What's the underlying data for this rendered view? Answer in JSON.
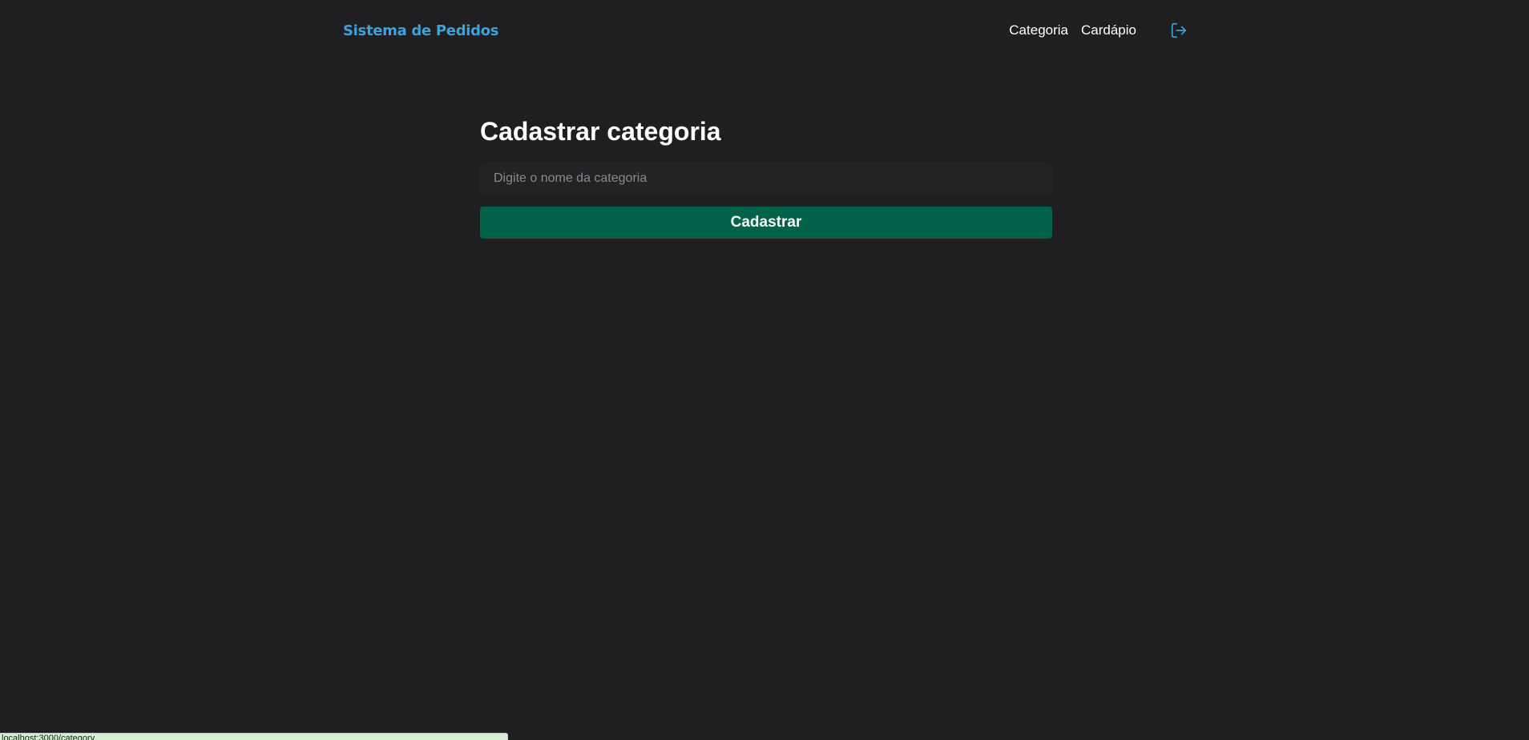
{
  "header": {
    "brand": "Sistema de Pedidos",
    "nav": [
      {
        "label": "Categoria"
      },
      {
        "label": "Cardápio"
      }
    ],
    "logout_icon": "logout-icon"
  },
  "main": {
    "title": "Cadastrar categoria",
    "input": {
      "value": "",
      "placeholder": "Digite o nome da categoria"
    },
    "submit_label": "Cadastrar"
  },
  "status_bar": {
    "text": "localhost:3000/category"
  },
  "colors": {
    "background": "#1f1f21",
    "brand": "#3fa1d6",
    "button": "#02634a",
    "input_bg": "#232325"
  }
}
